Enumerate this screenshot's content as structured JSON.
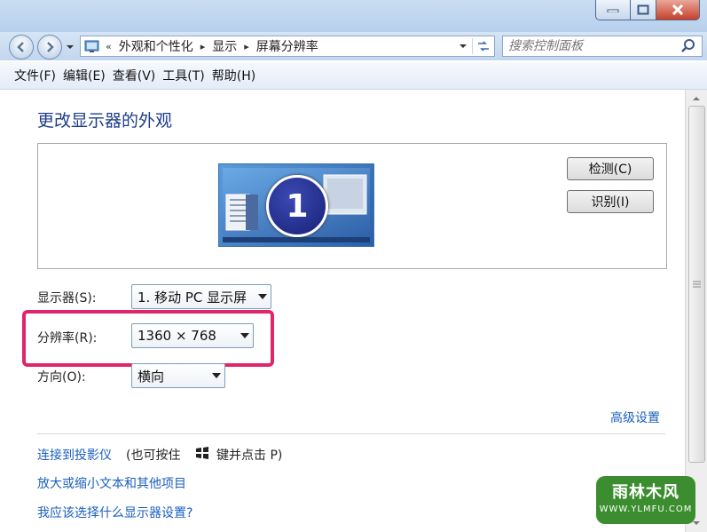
{
  "address": {
    "chevrons": "«",
    "crumbs": [
      "外观和个性化",
      "显示",
      "屏幕分辨率"
    ]
  },
  "search": {
    "placeholder": "搜索控制面板"
  },
  "menu": [
    "文件(F)",
    "编辑(E)",
    "查看(V)",
    "工具(T)",
    "帮助(H)"
  ],
  "page": {
    "title": "更改显示器的外观"
  },
  "preview": {
    "monitor_number": "1",
    "detect_label": "检测(C)",
    "identify_label": "识别(I)"
  },
  "settings": {
    "display": {
      "label": "显示器(S):",
      "value": "1. 移动 PC 显示屏"
    },
    "resolution": {
      "label": "分辨率(R):",
      "value": "1360 × 768"
    },
    "orientation": {
      "label": "方向(O):",
      "value": "横向"
    }
  },
  "links": {
    "advanced": "高级设置",
    "projector": "连接到投影仪",
    "projector_hint_before": "(也可按住",
    "projector_hint_after": "键并点击 P)",
    "text_size": "放大或缩小文本和其他项目",
    "which_settings": "我应该选择什么显示器设置?"
  },
  "watermark": {
    "main": "雨林木风",
    "sub": "WWW.YLMFU.COM"
  },
  "colors": {
    "highlight": "#e0256b",
    "link": "#1b5fbd",
    "title": "#1e3c8a"
  }
}
